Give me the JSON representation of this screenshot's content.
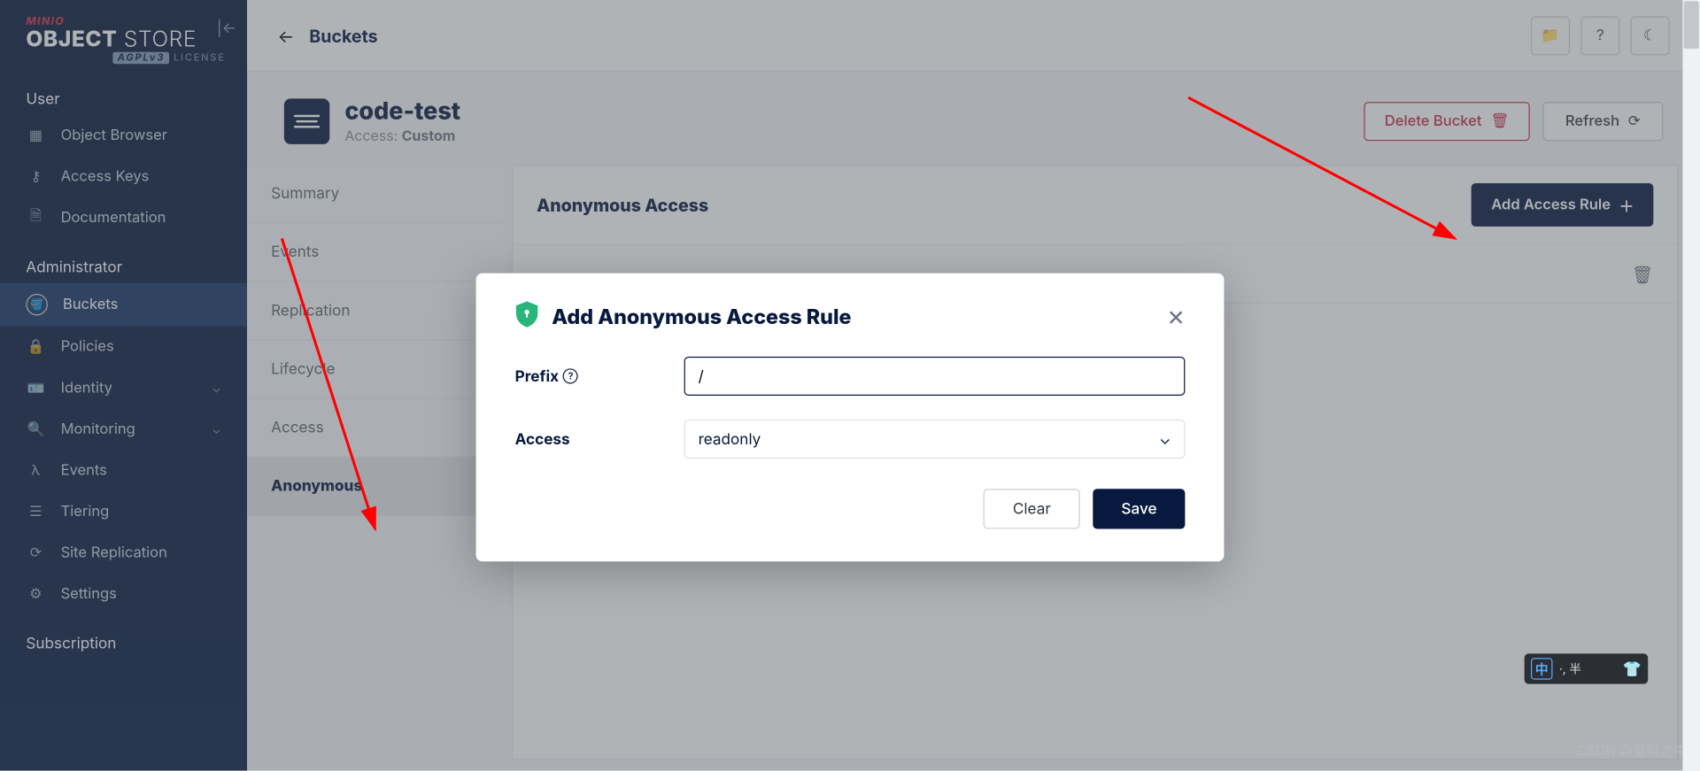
{
  "logo": {
    "brand": "MINIO",
    "main_bold": "OBJECT",
    "main_thin": " STORE",
    "license_tag": "AGPLv3",
    "license": "LICENSE"
  },
  "nav": {
    "user_section": "User",
    "user_items": [
      {
        "label": "Object Browser",
        "icon": "grid"
      },
      {
        "label": "Access Keys",
        "icon": "key"
      },
      {
        "label": "Documentation",
        "icon": "doc"
      }
    ],
    "admin_section": "Administrator",
    "admin_items": [
      {
        "label": "Buckets",
        "icon": "bucket",
        "active": true
      },
      {
        "label": "Policies",
        "icon": "lock"
      },
      {
        "label": "Identity",
        "icon": "id",
        "expandable": true
      },
      {
        "label": "Monitoring",
        "icon": "search",
        "expandable": true
      },
      {
        "label": "Events",
        "icon": "lambda"
      },
      {
        "label": "Tiering",
        "icon": "layers"
      },
      {
        "label": "Site Replication",
        "icon": "cycle"
      },
      {
        "label": "Settings",
        "icon": "gear"
      }
    ],
    "sub_section": "Subscription"
  },
  "breadcrumb": "Buckets",
  "bucket": {
    "name": "code-test",
    "access_label": "Access:",
    "access_value": "Custom",
    "delete": "Delete Bucket",
    "refresh": "Refresh"
  },
  "subnav": [
    "Summary",
    "Events",
    "Replication",
    "Lifecycle",
    "Access",
    "Anonymous"
  ],
  "panel": {
    "title": "Anonymous Access",
    "add": "Add Access Rule"
  },
  "modal": {
    "title": "Add Anonymous Access Rule",
    "prefix_label": "Prefix",
    "prefix_value": "/",
    "access_label": "Access",
    "access_value": "readonly",
    "clear": "Clear",
    "save": "Save"
  },
  "ime": {
    "ch": "中",
    "mid": "·, 半"
  },
  "watermark": "CSDN @意料之中"
}
